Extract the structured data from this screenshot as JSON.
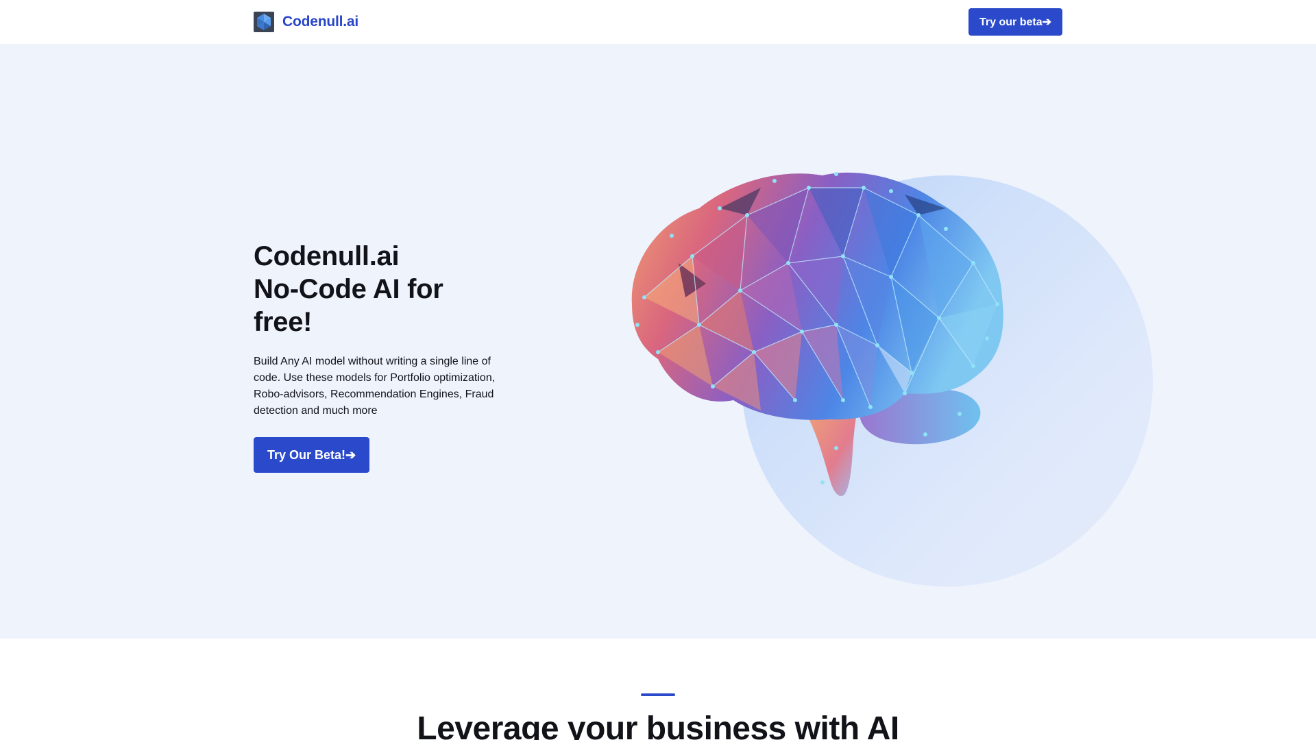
{
  "navbar": {
    "brand_name": "Codenull.ai",
    "logo_icon": "hexagon-logo-icon",
    "cta_label": "Try our beta➔"
  },
  "hero": {
    "title_lines": [
      "Codenull.ai",
      "No-Code AI for",
      "free!"
    ],
    "description": "Build Any AI model without writing a single line of code. Use these models for Portfolio optimization, Robo-advisors, Recommendation Engines, Fraud detection and much more",
    "cta_label": "Try Our Beta!➔",
    "illustration": "low-poly-brain-illustration"
  },
  "section_two": {
    "title": "Leverage your business with AI"
  },
  "colors": {
    "brand_blue": "#2b4acb",
    "hero_background": "#eef3fc",
    "circle_blue": "#b8d2f7",
    "text_dark": "#111318"
  }
}
